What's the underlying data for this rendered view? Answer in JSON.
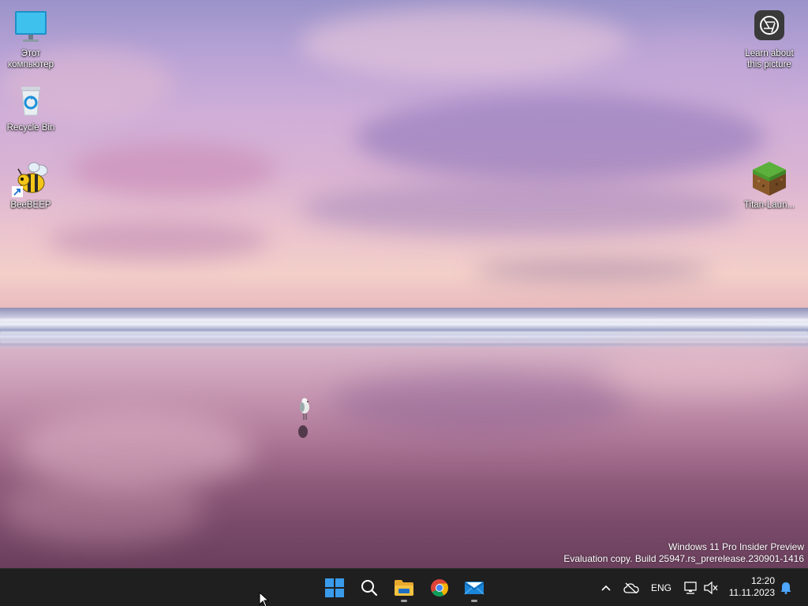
{
  "desktop": {
    "icons": [
      {
        "label": "Этот\nкомпьютер",
        "icon": "monitor-icon"
      },
      {
        "label": "Recycle Bin",
        "icon": "recycle-bin-icon"
      },
      {
        "label": "BeeBEEP",
        "icon": "bee-icon",
        "shortcut": true
      },
      {
        "label": "Learn about\nthis picture",
        "icon": "camera-icon"
      },
      {
        "label": "Titan-Laun...",
        "icon": "grass-block-icon"
      }
    ]
  },
  "watermark": {
    "line1": "Windows 11 Pro Insider Preview",
    "line2": "Evaluation copy. Build 25947.rs_prerelease.230901-1416"
  },
  "taskbar": {
    "pinned": [
      {
        "name": "Start",
        "icon": "windows-start-icon",
        "running": false
      },
      {
        "name": "Search",
        "icon": "search-icon",
        "running": false
      },
      {
        "name": "File Explorer",
        "icon": "folder-icon",
        "running": true
      },
      {
        "name": "Google Chrome",
        "icon": "chrome-icon",
        "running": false
      },
      {
        "name": "Mail",
        "icon": "mail-icon",
        "running": true
      }
    ],
    "tray": {
      "language": "ENG",
      "time": "12:20",
      "date": "11.11.2023"
    }
  },
  "colors": {
    "taskbar_bg": "#1f1f1f",
    "start_blue": "#3a9bea",
    "folder_yellow": "#f6c341"
  }
}
